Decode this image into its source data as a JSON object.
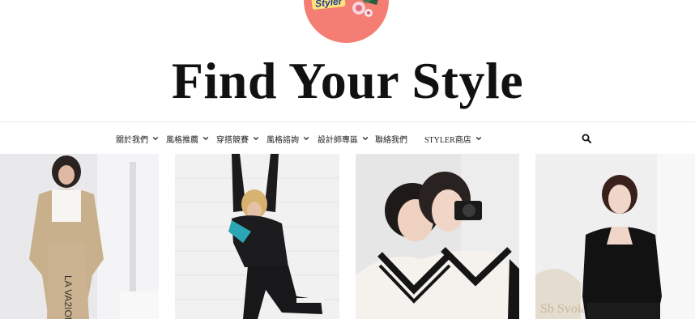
{
  "logo": {
    "badge_text": "Styler",
    "circle_color": "#f47e73"
  },
  "site_title": "Find Your Style",
  "nav": {
    "items": [
      {
        "label": "關於我們",
        "has_dropdown": true
      },
      {
        "label": "風格推薦",
        "has_dropdown": true
      },
      {
        "label": "穿搭競賽",
        "has_dropdown": true
      },
      {
        "label": "風格諮詢",
        "has_dropdown": true
      },
      {
        "label": "設計師專區",
        "has_dropdown": true
      },
      {
        "label": "聯絡我們",
        "has_dropdown": false
      },
      {
        "label": "STYLER商店",
        "has_dropdown": true
      }
    ],
    "search_icon": "search-icon"
  },
  "gallery": [
    {
      "subject": "woman in beige knit lounge set"
    },
    {
      "subject": "woman in black sporty tracksuit"
    },
    {
      "subject": "two women in v-neck knit sweaters with camera"
    },
    {
      "subject": "woman in black cutout top"
    }
  ]
}
